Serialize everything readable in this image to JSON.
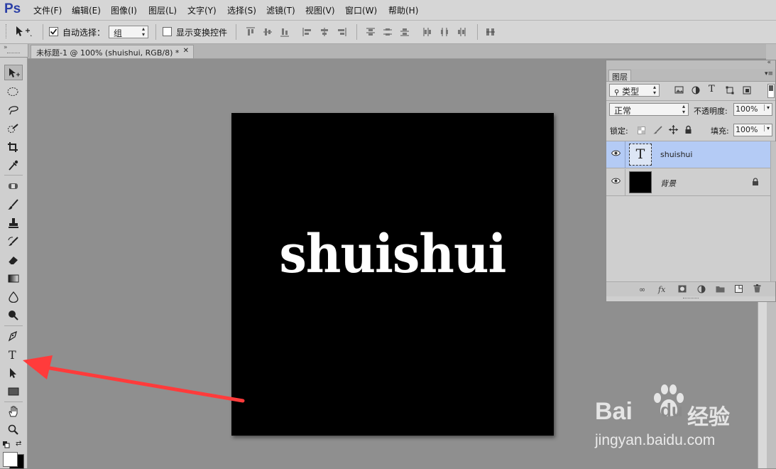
{
  "app": {
    "logo": "Ps"
  },
  "menu": [
    "文件(F)",
    "编辑(E)",
    "图像(I)",
    "图层(L)",
    "文字(Y)",
    "选择(S)",
    "滤镜(T)",
    "视图(V)",
    "窗口(W)",
    "帮助(H)"
  ],
  "options": {
    "auto_select_label": "自动选择：",
    "auto_select_checked": true,
    "auto_select_value": "组",
    "show_transform_label": "显示变换控件",
    "show_transform_checked": false
  },
  "document": {
    "tab_title": "未标题-1 @ 100% (shuishui, RGB/8) *",
    "canvas_text": "shuishui",
    "canvas_color": "#000000",
    "text_color": "#ffffff"
  },
  "layers_panel": {
    "tab_label": "图层",
    "filter_kind": "类型",
    "blend_mode": "正常",
    "opacity_label": "不透明度:",
    "opacity_value": "100%",
    "lock_label": "锁定:",
    "fill_label": "填充:",
    "fill_value": "100%",
    "layers": [
      {
        "name": "shuishui",
        "type": "text",
        "thumb_glyph": "T",
        "selected": true
      },
      {
        "name": "背景",
        "type": "background",
        "locked": true,
        "selected": false
      }
    ],
    "footer_fx": "fx"
  },
  "watermark": {
    "brand": "Bai",
    "brand2": "du",
    "product": "经验",
    "url": "jingyan.baidu.com"
  },
  "colors": {
    "accent": "#2b3fa6",
    "selection": "#b4cbf5",
    "arrow": "#ff3b3b"
  }
}
